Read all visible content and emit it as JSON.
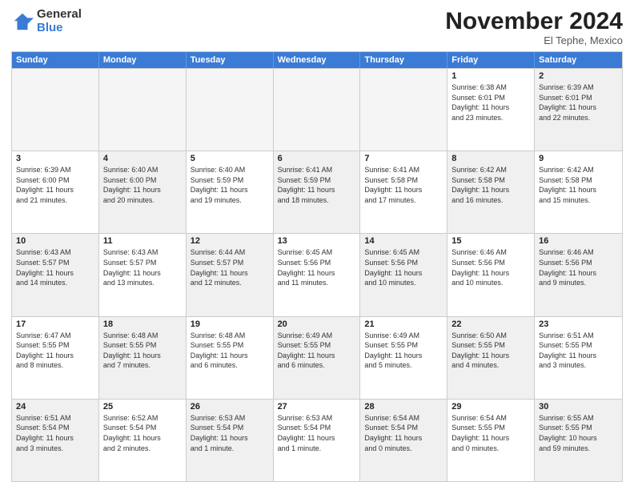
{
  "logo": {
    "general": "General",
    "blue": "Blue"
  },
  "title": "November 2024",
  "location": "El Tephe, Mexico",
  "header_days": [
    "Sunday",
    "Monday",
    "Tuesday",
    "Wednesday",
    "Thursday",
    "Friday",
    "Saturday"
  ],
  "weeks": [
    [
      {
        "day": "",
        "text": "",
        "shaded": true
      },
      {
        "day": "",
        "text": "",
        "shaded": true
      },
      {
        "day": "",
        "text": "",
        "shaded": true
      },
      {
        "day": "",
        "text": "",
        "shaded": true
      },
      {
        "day": "",
        "text": "",
        "shaded": true
      },
      {
        "day": "1",
        "text": "Sunrise: 6:38 AM\nSunset: 6:01 PM\nDaylight: 11 hours\nand 23 minutes."
      },
      {
        "day": "2",
        "text": "Sunrise: 6:39 AM\nSunset: 6:01 PM\nDaylight: 11 hours\nand 22 minutes.",
        "shaded": true
      }
    ],
    [
      {
        "day": "3",
        "text": "Sunrise: 6:39 AM\nSunset: 6:00 PM\nDaylight: 11 hours\nand 21 minutes."
      },
      {
        "day": "4",
        "text": "Sunrise: 6:40 AM\nSunset: 6:00 PM\nDaylight: 11 hours\nand 20 minutes.",
        "shaded": true
      },
      {
        "day": "5",
        "text": "Sunrise: 6:40 AM\nSunset: 5:59 PM\nDaylight: 11 hours\nand 19 minutes."
      },
      {
        "day": "6",
        "text": "Sunrise: 6:41 AM\nSunset: 5:59 PM\nDaylight: 11 hours\nand 18 minutes.",
        "shaded": true
      },
      {
        "day": "7",
        "text": "Sunrise: 6:41 AM\nSunset: 5:58 PM\nDaylight: 11 hours\nand 17 minutes."
      },
      {
        "day": "8",
        "text": "Sunrise: 6:42 AM\nSunset: 5:58 PM\nDaylight: 11 hours\nand 16 minutes.",
        "shaded": true
      },
      {
        "day": "9",
        "text": "Sunrise: 6:42 AM\nSunset: 5:58 PM\nDaylight: 11 hours\nand 15 minutes."
      }
    ],
    [
      {
        "day": "10",
        "text": "Sunrise: 6:43 AM\nSunset: 5:57 PM\nDaylight: 11 hours\nand 14 minutes.",
        "shaded": true
      },
      {
        "day": "11",
        "text": "Sunrise: 6:43 AM\nSunset: 5:57 PM\nDaylight: 11 hours\nand 13 minutes."
      },
      {
        "day": "12",
        "text": "Sunrise: 6:44 AM\nSunset: 5:57 PM\nDaylight: 11 hours\nand 12 minutes.",
        "shaded": true
      },
      {
        "day": "13",
        "text": "Sunrise: 6:45 AM\nSunset: 5:56 PM\nDaylight: 11 hours\nand 11 minutes."
      },
      {
        "day": "14",
        "text": "Sunrise: 6:45 AM\nSunset: 5:56 PM\nDaylight: 11 hours\nand 10 minutes.",
        "shaded": true
      },
      {
        "day": "15",
        "text": "Sunrise: 6:46 AM\nSunset: 5:56 PM\nDaylight: 11 hours\nand 10 minutes."
      },
      {
        "day": "16",
        "text": "Sunrise: 6:46 AM\nSunset: 5:56 PM\nDaylight: 11 hours\nand 9 minutes.",
        "shaded": true
      }
    ],
    [
      {
        "day": "17",
        "text": "Sunrise: 6:47 AM\nSunset: 5:55 PM\nDaylight: 11 hours\nand 8 minutes."
      },
      {
        "day": "18",
        "text": "Sunrise: 6:48 AM\nSunset: 5:55 PM\nDaylight: 11 hours\nand 7 minutes.",
        "shaded": true
      },
      {
        "day": "19",
        "text": "Sunrise: 6:48 AM\nSunset: 5:55 PM\nDaylight: 11 hours\nand 6 minutes."
      },
      {
        "day": "20",
        "text": "Sunrise: 6:49 AM\nSunset: 5:55 PM\nDaylight: 11 hours\nand 6 minutes.",
        "shaded": true
      },
      {
        "day": "21",
        "text": "Sunrise: 6:49 AM\nSunset: 5:55 PM\nDaylight: 11 hours\nand 5 minutes."
      },
      {
        "day": "22",
        "text": "Sunrise: 6:50 AM\nSunset: 5:55 PM\nDaylight: 11 hours\nand 4 minutes.",
        "shaded": true
      },
      {
        "day": "23",
        "text": "Sunrise: 6:51 AM\nSunset: 5:55 PM\nDaylight: 11 hours\nand 3 minutes."
      }
    ],
    [
      {
        "day": "24",
        "text": "Sunrise: 6:51 AM\nSunset: 5:54 PM\nDaylight: 11 hours\nand 3 minutes.",
        "shaded": true
      },
      {
        "day": "25",
        "text": "Sunrise: 6:52 AM\nSunset: 5:54 PM\nDaylight: 11 hours\nand 2 minutes."
      },
      {
        "day": "26",
        "text": "Sunrise: 6:53 AM\nSunset: 5:54 PM\nDaylight: 11 hours\nand 1 minute.",
        "shaded": true
      },
      {
        "day": "27",
        "text": "Sunrise: 6:53 AM\nSunset: 5:54 PM\nDaylight: 11 hours\nand 1 minute."
      },
      {
        "day": "28",
        "text": "Sunrise: 6:54 AM\nSunset: 5:54 PM\nDaylight: 11 hours\nand 0 minutes.",
        "shaded": true
      },
      {
        "day": "29",
        "text": "Sunrise: 6:54 AM\nSunset: 5:55 PM\nDaylight: 11 hours\nand 0 minutes."
      },
      {
        "day": "30",
        "text": "Sunrise: 6:55 AM\nSunset: 5:55 PM\nDaylight: 10 hours\nand 59 minutes.",
        "shaded": true
      }
    ]
  ]
}
